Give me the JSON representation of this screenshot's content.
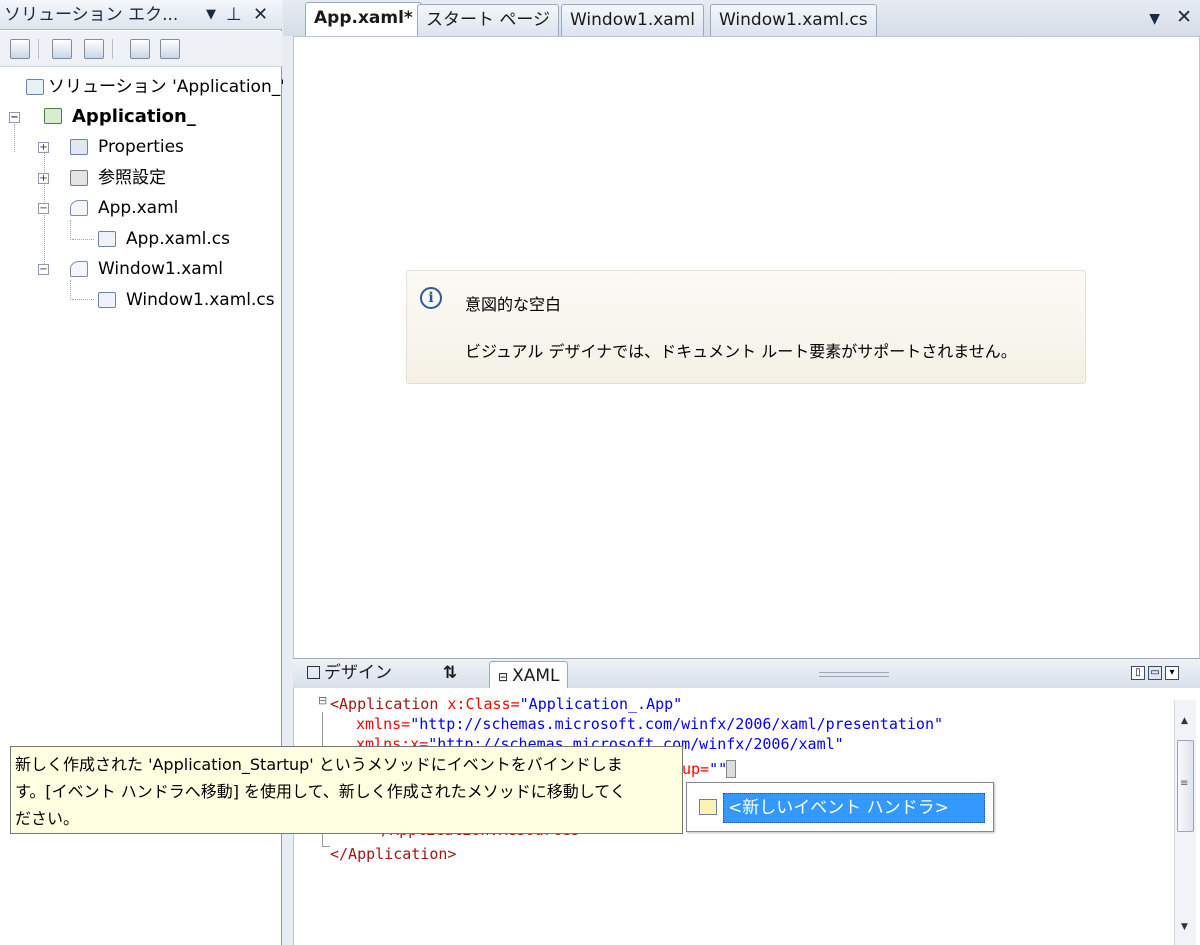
{
  "solution_explorer": {
    "title": "ソリューション エク...",
    "controls": [
      "▼",
      "⊥",
      "✕"
    ],
    "tree": [
      {
        "label": "ソリューション 'Application_'",
        "icon": "solution-icon"
      },
      {
        "label": "Application_",
        "icon": "csharp-project-icon",
        "bold": true
      },
      {
        "label": "Properties",
        "icon": "properties-folder-icon"
      },
      {
        "label": "参照設定",
        "icon": "references-icon"
      },
      {
        "label": "App.xaml",
        "icon": "xaml-file-icon"
      },
      {
        "label": "App.xaml.cs",
        "icon": "cs-file-icon"
      },
      {
        "label": "Window1.xaml",
        "icon": "xaml-file-icon"
      },
      {
        "label": "Window1.xaml.cs",
        "icon": "cs-file-icon"
      }
    ]
  },
  "tabs": [
    {
      "label": "App.xaml*",
      "active": true
    },
    {
      "label": "スタート ページ"
    },
    {
      "label": "Window1.xaml"
    },
    {
      "label": "Window1.xaml.cs"
    }
  ],
  "doc_controls": [
    "▼",
    "✕"
  ],
  "info": {
    "icon_glyph": "i",
    "title": "意図的な空白",
    "message": "ビジュアル デザイナでは、ドキュメント ルート要素がサポートされません。"
  },
  "view_switcher": {
    "design": "デザイン",
    "swap": "⇅",
    "xaml": "XAML",
    "collapse_glyph": "⊟"
  },
  "code": {
    "line1_tag": "<Application",
    "line1_attr": " x:Class=",
    "line1_val": "\"Application_.App\"",
    "line2_attr": "xmlns=",
    "line2_val": "\"http://schemas.microsoft.com/winfx/2006/xaml/presentation\"",
    "line3_attr": "xmlns:x=",
    "line3_val": "\"http://schemas.microsoft.com/winfx/2006/xaml\"",
    "line4_attr": "up=",
    "line4_val": "\"\"",
    "line4_end": ">",
    "line6": "</Application.Resources>",
    "line7": "</Application>"
  },
  "tooltip": {
    "line1": "新しく作成された 'Application_Startup' というメソッドにイベントをバインドしま",
    "line2": "す。[イベント ハンドラへ移動] を使用して、新しく作成されたメソッドに移動してく",
    "line3": "ださい。"
  },
  "intellisense": {
    "item": "<新しいイベント ハンドラ>"
  },
  "colors": {
    "chrome": "#e9edf3",
    "selection": "#3399ff",
    "tooltip_bg": "#ffffe1",
    "xml_tag": "#a31515",
    "xml_attr": "#ff0000",
    "xml_value": "#0000ff"
  }
}
